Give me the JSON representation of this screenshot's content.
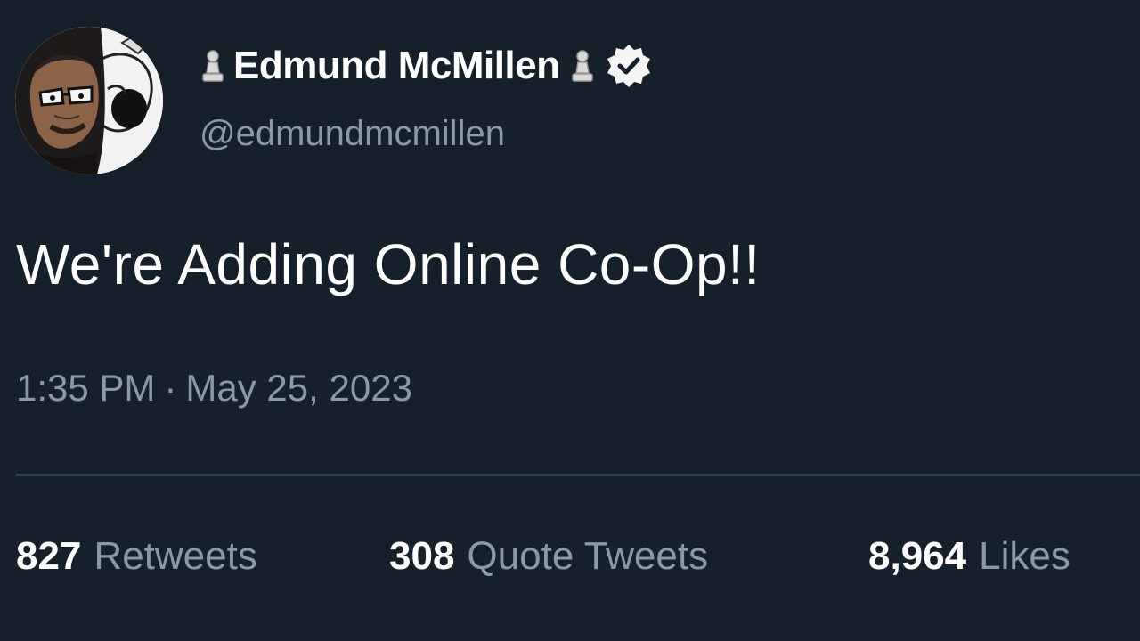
{
  "author": {
    "display_name": "Edmund McMillen",
    "handle": "@edmundmcmillen",
    "name_emoji_icon": "chess-pawn-icon",
    "verified_icon": "verified-badge-icon",
    "avatar_icon": "caricature-avatar"
  },
  "tweet": {
    "text": "We're Adding Online Co-Op!!",
    "time": "1:35 PM",
    "separator": "·",
    "date": "May 25, 2023"
  },
  "stats": {
    "retweets": {
      "count": "827",
      "label": "Retweets"
    },
    "quote_tweets": {
      "count": "308",
      "label": "Quote Tweets"
    },
    "likes": {
      "count": "8,964",
      "label": "Likes"
    }
  },
  "colors": {
    "background": "#15202b",
    "primary_text": "#ffffff",
    "secondary_text": "#8b98a5",
    "divider": "#38444d"
  }
}
